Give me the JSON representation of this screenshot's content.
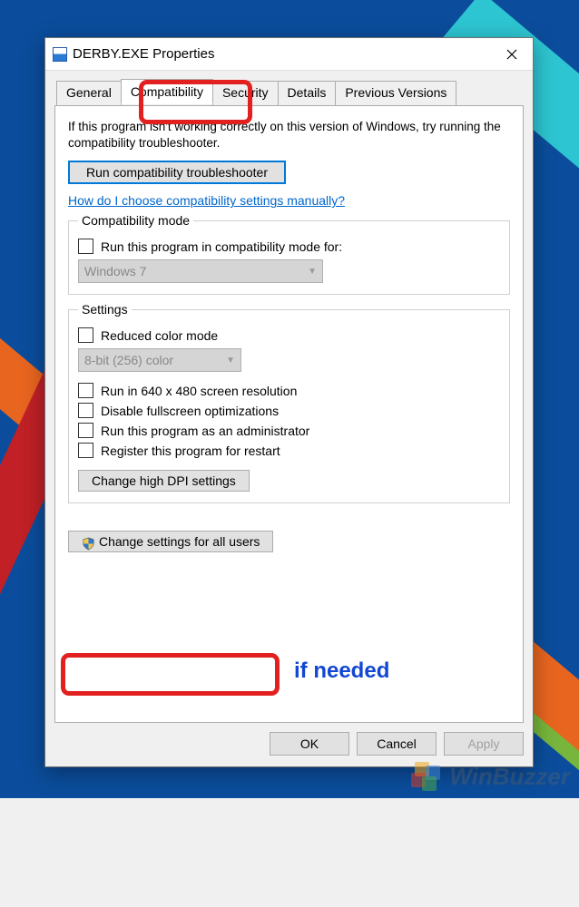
{
  "window": {
    "title": "DERBY.EXE Properties"
  },
  "tabs": {
    "general": "General",
    "compatibility": "Compatibility",
    "security": "Security",
    "details": "Details",
    "previous": "Previous Versions"
  },
  "intro": "If this program isn't working correctly on this version of Windows, try running the compatibility troubleshooter.",
  "troubleshoot_btn": "Run compatibility troubleshooter",
  "help_link": "How do I choose compatibility settings manually?",
  "compat_mode": {
    "legend": "Compatibility mode",
    "chk_label": "Run this program in compatibility mode for:",
    "dropdown": "Windows 7"
  },
  "settings": {
    "legend": "Settings",
    "reduced_color": "Reduced color mode",
    "color_dropdown": "8-bit (256) color",
    "low_res": "Run in 640 x 480 screen resolution",
    "disable_fullscreen": "Disable fullscreen optimizations",
    "run_admin": "Run this program as an administrator",
    "register_restart": "Register this program for restart",
    "high_dpi_btn": "Change high DPI settings"
  },
  "all_users_btn": "Change settings for all users",
  "footer": {
    "ok": "OK",
    "cancel": "Cancel",
    "apply": "Apply"
  },
  "annotation": {
    "if_needed": "if needed"
  },
  "watermark": "WinBuzzer"
}
